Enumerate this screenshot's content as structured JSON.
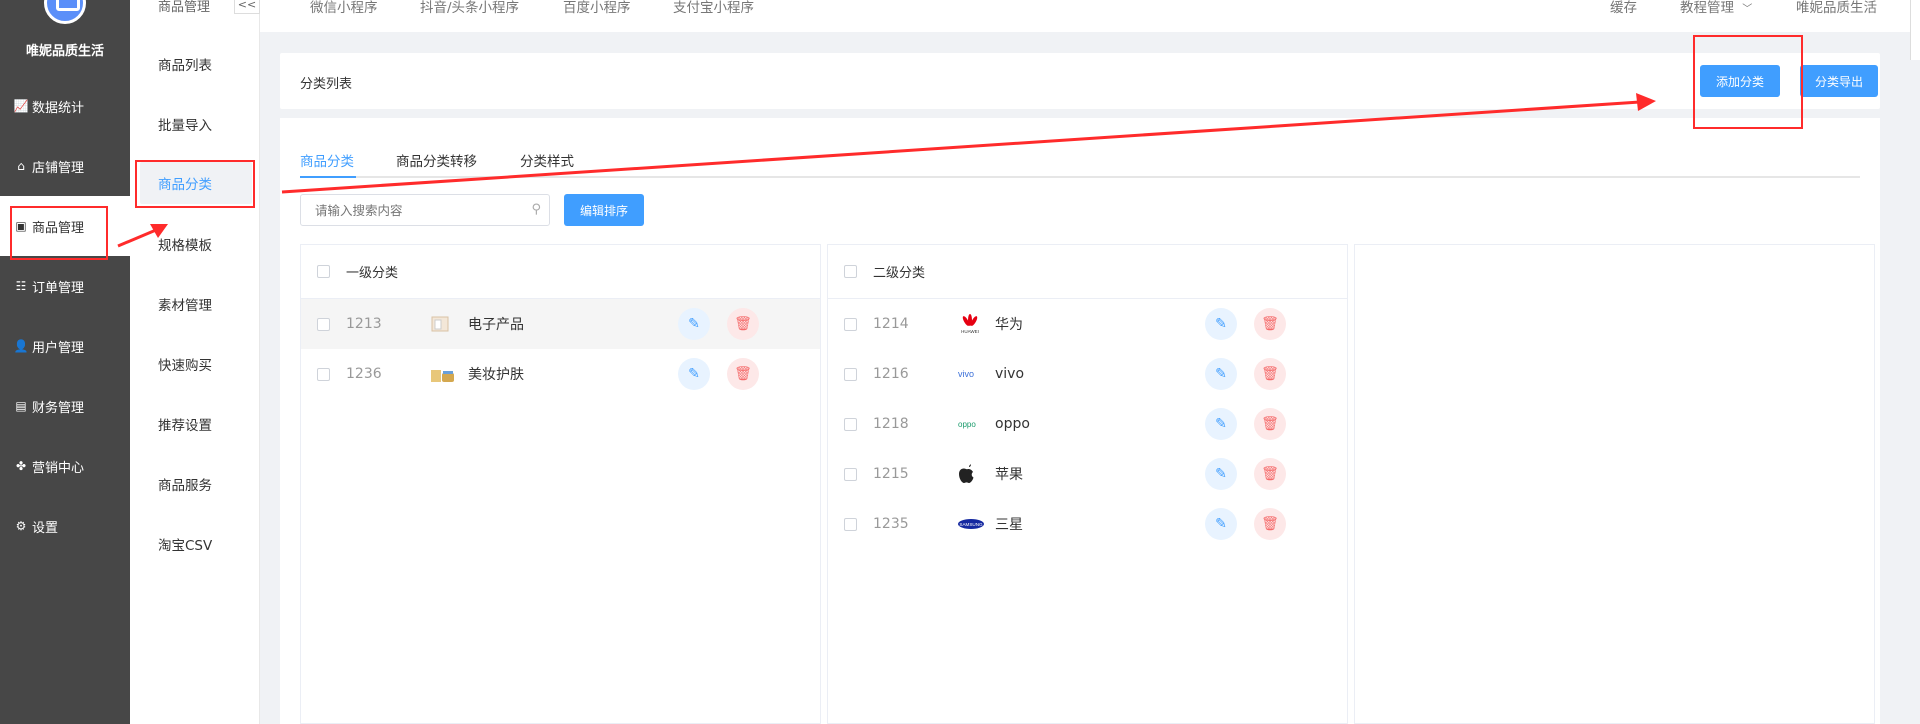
{
  "brand": {
    "name": "唯妮品质生活"
  },
  "sidebar": {
    "items": [
      {
        "label": "数据统计",
        "icon": "chart-icon"
      },
      {
        "label": "店铺管理",
        "icon": "store-icon"
      },
      {
        "label": "商品管理",
        "icon": "goods-icon"
      },
      {
        "label": "订单管理",
        "icon": "order-icon"
      },
      {
        "label": "用户管理",
        "icon": "user-icon"
      },
      {
        "label": "财务管理",
        "icon": "finance-icon"
      },
      {
        "label": "营销中心",
        "icon": "marketing-icon"
      },
      {
        "label": "设置",
        "icon": "gear-icon"
      }
    ]
  },
  "subnav": {
    "header": "商品管理",
    "collapse": "<<",
    "items": [
      "商品列表",
      "批量导入",
      "商品分类",
      "规格模板",
      "素材管理",
      "快速购买",
      "推荐设置",
      "商品服务",
      "淘宝CSV"
    ]
  },
  "topbar": {
    "tabs": [
      "微信小程序",
      "抖音/头条小程序",
      "百度小程序",
      "支付宝小程序"
    ],
    "right": [
      "缓存",
      "教程管理",
      "唯妮品质生活"
    ]
  },
  "page": {
    "title": "分类列表",
    "add_button": "添加分类",
    "export_button": "分类导出",
    "tabs": [
      "商品分类",
      "商品分类转移",
      "分类样式"
    ],
    "search_placeholder": "请输入搜索内容",
    "sort_button": "编辑排序"
  },
  "level1": {
    "header": "一级分类",
    "rows": [
      {
        "id": "1213",
        "name": "电子产品"
      },
      {
        "id": "1236",
        "name": "美妆护肤"
      }
    ]
  },
  "level2": {
    "header": "二级分类",
    "rows": [
      {
        "id": "1214",
        "name": "华为",
        "logo_text": "HUAWEI"
      },
      {
        "id": "1216",
        "name": "vivo",
        "logo_text": "vivo"
      },
      {
        "id": "1218",
        "name": "oppo",
        "logo_text": "oppo"
      },
      {
        "id": "1215",
        "name": "苹果",
        "logo_text": ""
      },
      {
        "id": "1235",
        "name": "三星",
        "logo_text": "SAMSUNG"
      }
    ]
  },
  "colors": {
    "primary": "#409eff",
    "danger": "#f56c6c",
    "sidebar": "#474747",
    "annotation": "#ff2b2b"
  }
}
